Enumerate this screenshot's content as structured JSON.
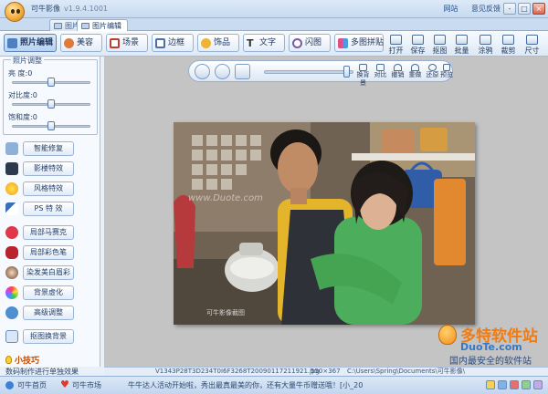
{
  "window": {
    "title": "可牛影像",
    "version": "v1.9.4.1001",
    "links": [
      "网站",
      "意见反馈"
    ],
    "controls": [
      "-",
      "□",
      "×"
    ]
  },
  "tabs": [
    {
      "label": "图片浏",
      "active": false
    },
    {
      "label": "图片编辑",
      "active": true
    }
  ],
  "toolbar": {
    "categories": [
      {
        "label": "照片编辑",
        "icon": "photo-edit-icon",
        "active": true
      },
      {
        "label": "美容",
        "icon": "beauty-icon",
        "active": false
      },
      {
        "label": "场景",
        "icon": "scene-icon",
        "active": false
      },
      {
        "label": "边框",
        "icon": "frame-icon",
        "active": false
      },
      {
        "label": "饰品",
        "icon": "accessory-icon",
        "active": false
      },
      {
        "label": "文字",
        "icon": "text-icon",
        "active": false
      },
      {
        "label": "闪图",
        "icon": "flash-icon",
        "active": false
      },
      {
        "label": "多图拼贴",
        "icon": "collage-icon",
        "active": false
      }
    ],
    "actions": [
      {
        "label": "打开",
        "icon": "open-icon"
      },
      {
        "label": "保存",
        "icon": "save-icon"
      },
      {
        "label": "抠图",
        "icon": "cutout-icon"
      },
      {
        "label": "批量",
        "icon": "batch-icon"
      },
      {
        "label": "涂鸦",
        "icon": "doodle-icon"
      },
      {
        "label": "裁剪",
        "icon": "crop-icon"
      },
      {
        "label": "尺寸",
        "icon": "resize-icon"
      }
    ]
  },
  "left_panel": {
    "adjust_title": "照片调整",
    "sliders": [
      {
        "label": "亮  度:",
        "value": "0",
        "level": 0.5
      },
      {
        "label": "对比度:",
        "value": "0",
        "level": 0.5
      },
      {
        "label": "饱和度:",
        "value": "0",
        "level": 0.5
      }
    ],
    "effects": [
      {
        "label": "智能修复",
        "icon": "smart-repair-icon"
      },
      {
        "label": "影楼特效",
        "icon": "studio-effect-icon"
      },
      {
        "label": "风格特效",
        "icon": "style-effect-icon"
      },
      {
        "label": "PS 特 效",
        "icon": "ps-effect-icon"
      },
      {
        "label": "局部马赛克",
        "icon": "mosaic-icon"
      },
      {
        "label": "局部彩色笔",
        "icon": "color-pen-icon"
      },
      {
        "label": "染发美白眉彩",
        "icon": "hair-dye-icon"
      },
      {
        "label": "背景虚化",
        "icon": "bg-blur-icon"
      },
      {
        "label": "高级调整",
        "icon": "advanced-adjust-icon"
      },
      {
        "label": "抠图换背景",
        "icon": "cutout-bg-icon"
      }
    ],
    "tips_title": "小技巧",
    "tips_text": "数码制作进行单独效果"
  },
  "canvas_toolbar": {
    "buttons": [
      "rotate-icon",
      "fit-screen-icon",
      "actual-size-icon"
    ],
    "zoom_level": 0.93,
    "actions": [
      {
        "label": "换背景",
        "icon": "swap-bg-icon"
      },
      {
        "label": "对比",
        "icon": "compare-icon"
      },
      {
        "label": "撤销",
        "icon": "undo-icon"
      },
      {
        "label": "重做",
        "icon": "redo-icon"
      },
      {
        "label": "还原",
        "icon": "restore-icon"
      },
      {
        "label": "预览",
        "icon": "preview-icon"
      }
    ]
  },
  "photo": {
    "watermark": "www.Duote.com",
    "caption": "可牛影像截图"
  },
  "site_watermark": {
    "brand": "多特软件站",
    "site": "DuoTe.com",
    "slogan": "国内最安全的软件站"
  },
  "image_info": {
    "filename": "V1343P28T3D234T0I6F3268T20090117211921.jpg",
    "size": "550×367",
    "path": "C:\\Users\\Spring\\Documents\\可牛影像\\"
  },
  "status": {
    "home": "可牛首页",
    "market": "可牛市场",
    "notice": "牛牛达人活动开始啦，秀出最真最美的你，还有大量牛币赠送哦！[小_20"
  },
  "colors": {
    "accent": "#5f86bb",
    "brand_orange": "#f27b10",
    "canvas_bg": "#c4c4c4"
  }
}
